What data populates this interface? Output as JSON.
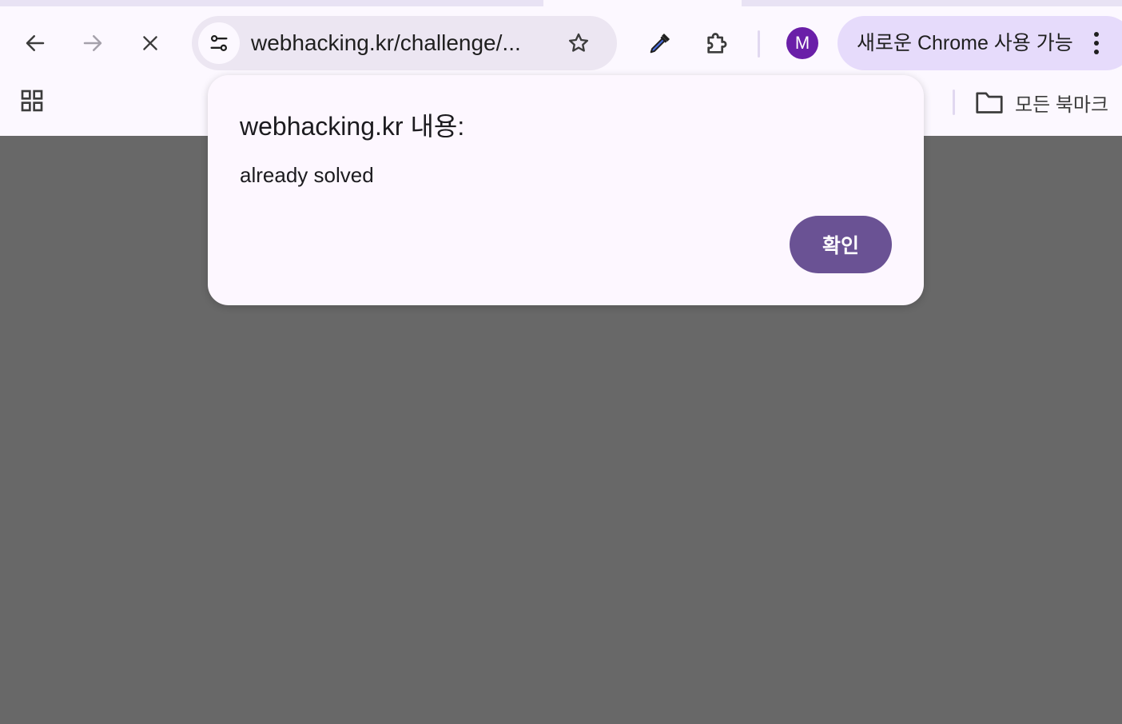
{
  "toolbar": {
    "url": "webhacking.kr/challenge/...",
    "profile_initial": "M",
    "update_label": "새로운 Chrome 사용 가능"
  },
  "bookmarks_bar": {
    "all_bookmarks_label": "모든 북마크"
  },
  "dialog": {
    "title": "webhacking.kr 내용:",
    "message": "already solved",
    "ok_label": "확인"
  },
  "icons": {
    "back": "arrow-left-icon",
    "forward": "arrow-right-icon",
    "stop": "close-icon",
    "site_info": "tune-icon",
    "bookmark": "star-icon",
    "eyedropper": "eyedropper-icon",
    "extensions": "puzzle-icon",
    "menu": "more-vert-icon",
    "apps": "apps-grid-icon",
    "folder": "folder-icon"
  },
  "colors": {
    "toolbar_bg": "#fcf8ff",
    "omnibox_bg": "#ece6f2",
    "update_chip_bg": "#e6dbfb",
    "avatar_bg": "#6a1fa8",
    "dialog_bg": "#fdf7ff",
    "ok_button_bg": "#6a5294",
    "page_overlay": "#686868"
  }
}
